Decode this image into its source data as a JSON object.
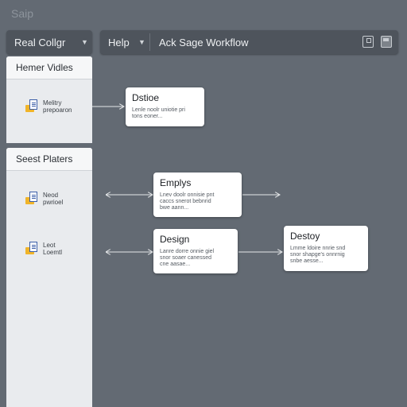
{
  "app": {
    "title": "Saip"
  },
  "toolbar": {
    "left_dropdown": "Real Collgr",
    "help_menu": "Help",
    "workflow_title": "Ack Sage Workflow",
    "icons": [
      "window-icon",
      "save-icon"
    ]
  },
  "sidebar": {
    "panels": [
      {
        "header": "Hemer Vidles",
        "items": [
          {
            "icon": "file-folder-icon",
            "label_line1": "Melitry",
            "label_line2": "prepoaron"
          }
        ]
      },
      {
        "header": "Seest Platers",
        "items": [
          {
            "icon": "file-folder-icon",
            "label_line1": "Neod",
            "label_line2": "pwrioel"
          },
          {
            "icon": "file-folder-icon",
            "label_line1": "Leot",
            "label_line2": "Loemtl"
          }
        ]
      }
    ]
  },
  "canvas": {
    "nodes": [
      {
        "title": "Dstioe",
        "desc_line1": "Lenle noolr uniotie pri",
        "desc_line2": "tons eoner..."
      },
      {
        "title": "Emplys",
        "desc_line1": "Lnev doolr onnisie pnt",
        "desc_line2": "caccs snerot bebnrid",
        "desc_line3": "bwe aann..."
      },
      {
        "title": "Design",
        "desc_line1": "Lanre dorre onnie giel",
        "desc_line2": "snor soaer canessed",
        "desc_line3": "cne aasae..."
      },
      {
        "title": "Destoy",
        "desc_line1": "Lmme ldoire nnrie snd",
        "desc_line2": "snor shapge's onnrnig",
        "desc_line3": "snbe aesse..."
      }
    ]
  },
  "colors": {
    "background": "#636a73",
    "toolbar": "#4e545c",
    "panel": "#e9ebee",
    "node": "#ffffff",
    "connector": "#e6e8ea"
  }
}
